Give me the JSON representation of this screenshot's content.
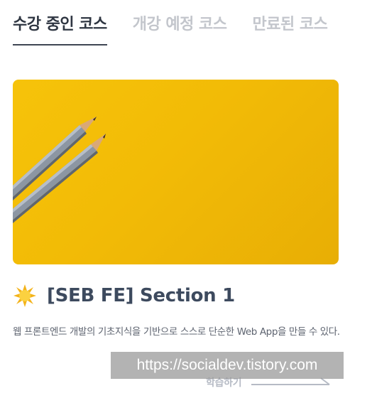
{
  "tabs": [
    {
      "label": "수강 중인 코스",
      "active": true
    },
    {
      "label": "개강 예정 코스",
      "active": false
    },
    {
      "label": "만료된 코스",
      "active": false
    }
  ],
  "course": {
    "icon": "sun-icon",
    "title": "[SEB FE] Section 1",
    "description": "웹 프론트엔드 개발의 기초지식을 기반으로 스스로 단순한 Web App을 만들 수 있다.",
    "thumbnail": "yellow-background-with-two-pencils",
    "learn_label": "학습하기"
  },
  "watermark": "https://socialdev.tistory.com",
  "colors": {
    "accent_dark": "#2f3642",
    "tab_inactive": "#c3c6cc",
    "thumbnail_yellow": "#f2bb06",
    "title": "#3d4a5e"
  }
}
